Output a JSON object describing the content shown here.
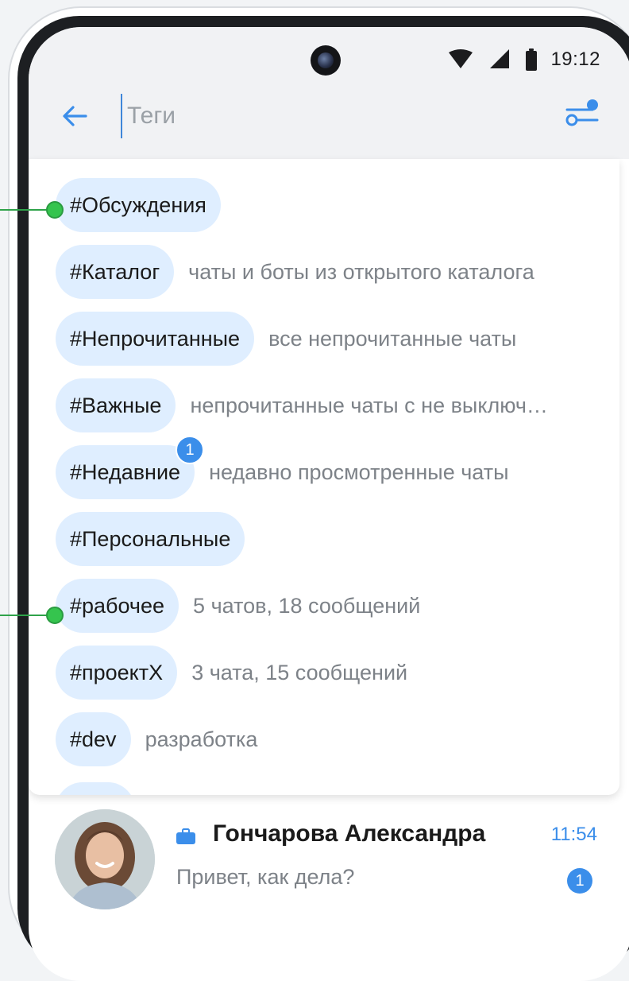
{
  "status_bar": {
    "time": "19:12"
  },
  "search": {
    "placeholder": "Теги",
    "value": ""
  },
  "tags": [
    {
      "label": "#Обсуждения",
      "desc": ""
    },
    {
      "label": "#Каталог",
      "desc": "чаты и боты из открытого каталога"
    },
    {
      "label": "#Непрочитанные",
      "desc": "все непрочитанные чаты"
    },
    {
      "label": "#Важные",
      "desc": "непрочитанные чаты с не выключ…"
    },
    {
      "label": "#Недавние",
      "desc": "недавно просмотренные чаты",
      "badge": "1"
    },
    {
      "label": "#Персональные",
      "desc": ""
    },
    {
      "label": "#рабочее",
      "desc": "5 чатов, 18 сообщений"
    },
    {
      "label": "#проектХ",
      "desc": "3 чата, 15 сообщений"
    },
    {
      "label": "#dev",
      "desc": "разработка"
    }
  ],
  "chat": {
    "name": "Гончарова Александра",
    "time": "11:54",
    "preview": "Привет, как дела?",
    "unread": "1"
  },
  "colors": {
    "accent": "#3b8eea",
    "chip_bg": "#dfeeff",
    "marker": "#35c44e"
  }
}
